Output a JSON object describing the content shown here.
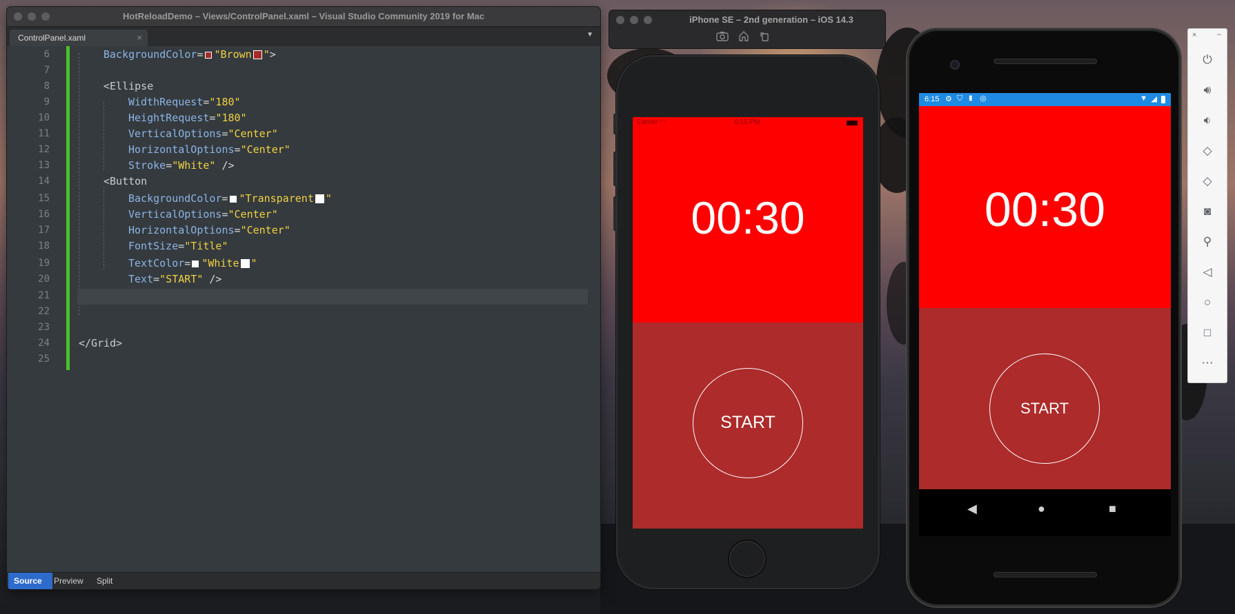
{
  "ide": {
    "title": "HotReloadDemo – Views/ControlPanel.xaml – Visual Studio Community 2019 for Mac",
    "tab_label": "ControlPanel.xaml",
    "tab_close": "×",
    "dropdown_icon": "chevron-down-icon",
    "bottom_tabs": [
      "Source",
      "Preview",
      "Split"
    ],
    "active_bottom_tab": "Source",
    "code_lines": [
      {
        "n": "6",
        "text": "BackgroundColor=\"Brown\">"
      },
      {
        "n": "7",
        "text": ""
      },
      {
        "n": "8",
        "text": "<Ellipse"
      },
      {
        "n": "9",
        "text": "WidthRequest=\"180\""
      },
      {
        "n": "10",
        "text": "HeightRequest=\"180\""
      },
      {
        "n": "11",
        "text": "VerticalOptions=\"Center\""
      },
      {
        "n": "12",
        "text": "HorizontalOptions=\"Center\""
      },
      {
        "n": "13",
        "text": "Stroke=\"White\" />"
      },
      {
        "n": "14",
        "text": "<Button"
      },
      {
        "n": "15",
        "text": "BackgroundColor=\"Transparent\""
      },
      {
        "n": "16",
        "text": "VerticalOptions=\"Center\""
      },
      {
        "n": "17",
        "text": "HorizontalOptions=\"Center\""
      },
      {
        "n": "18",
        "text": "FontSize=\"Title\""
      },
      {
        "n": "19",
        "text": "TextColor=\"White\""
      },
      {
        "n": "20",
        "text": "Text=\"START\" />"
      },
      {
        "n": "21",
        "text": ""
      },
      {
        "n": "22",
        "text": ""
      },
      {
        "n": "23",
        "text": ""
      },
      {
        "n": "24",
        "text": "</Grid>"
      },
      {
        "n": "25",
        "text": ""
      }
    ],
    "swatch_colors": {
      "brown": "#a52a2a",
      "white": "#ffffff"
    }
  },
  "ios_simulator": {
    "title": "iPhone SE – 2nd generation – iOS 14.3",
    "toolbar_icons": [
      "screenshot-icon",
      "home-icon",
      "rotate-icon"
    ],
    "status_carrier": "Carrier",
    "status_time": "6:15 PM",
    "timer": "00:30",
    "button_label": "START"
  },
  "android_emulator": {
    "status_time": "6:15",
    "timer": "00:30",
    "button_label": "START",
    "nav_icons": [
      "back-icon",
      "home-icon",
      "recents-icon"
    ]
  },
  "emulator_toolbar": {
    "close_label": "×",
    "minimize_label": "–",
    "tools": [
      "power-icon",
      "volume-up-icon",
      "volume-down-icon",
      "rotate-left-icon",
      "rotate-right-icon",
      "camera-icon",
      "zoom-icon",
      "back-icon",
      "home-icon",
      "overview-icon",
      "more-icon"
    ]
  },
  "colors": {
    "timer_red": "#fe0000",
    "body_brown": "#ad2b2b",
    "android_status_blue": "#1f8ae3",
    "change_bar_green": "#4cc12a",
    "active_tab_blue": "#2d6bcd"
  }
}
